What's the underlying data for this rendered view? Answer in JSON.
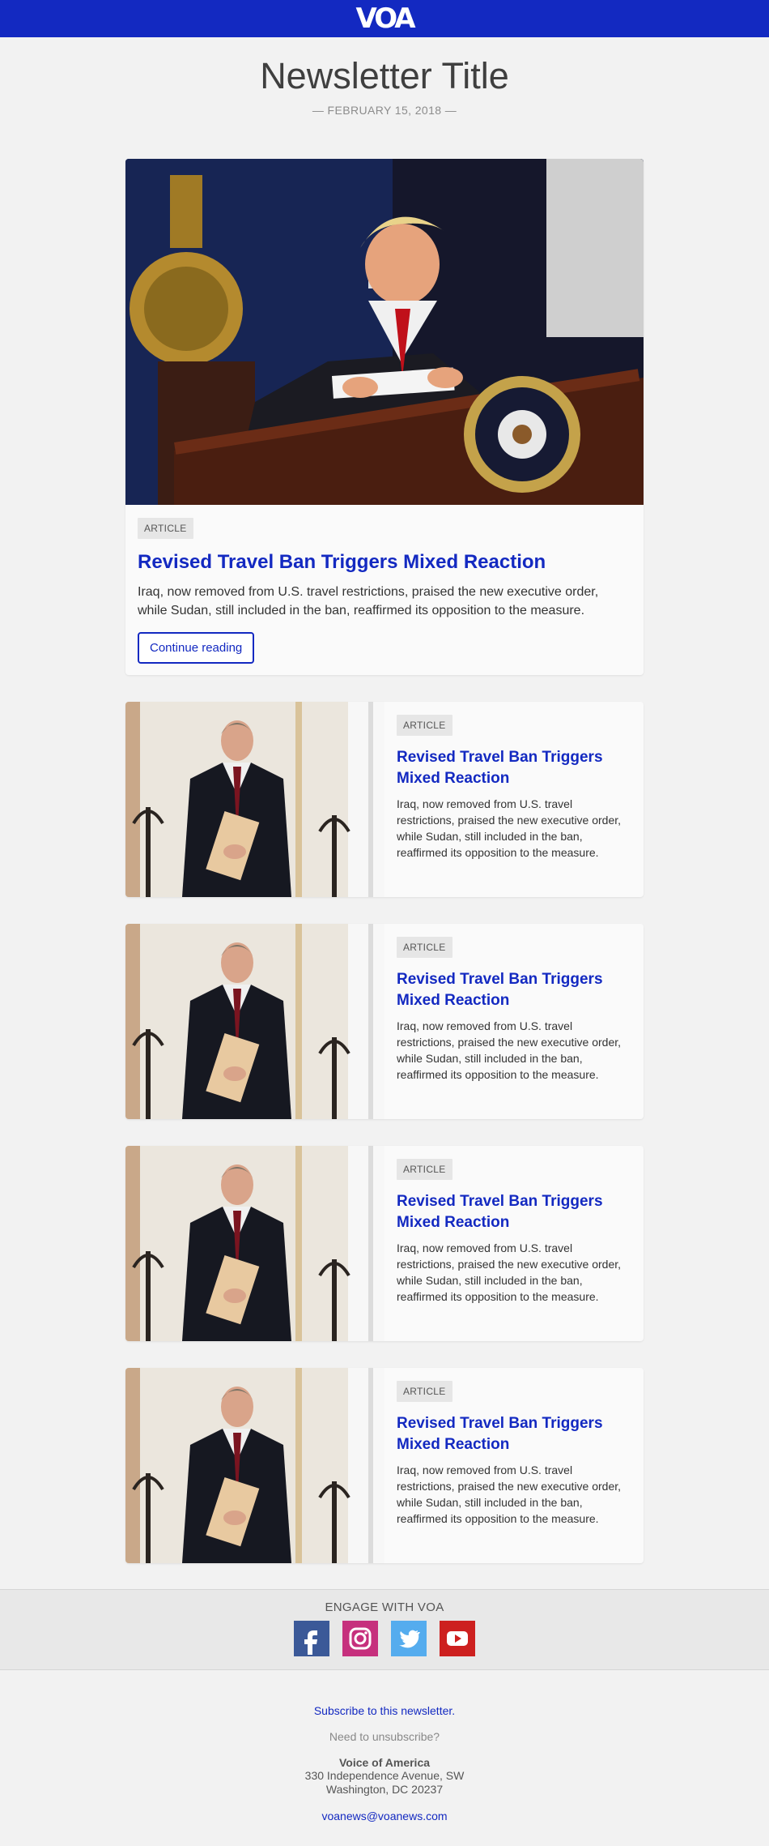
{
  "brand": {
    "logo_text": "VOA",
    "accent": "#1329c1"
  },
  "header": {
    "title": "Newsletter Title",
    "date": "— FEBRUARY 15, 2018 —"
  },
  "hero": {
    "tag": "ARTICLE",
    "headline": "Revised Travel Ban Triggers Mixed Reaction",
    "summary": "Iraq, now removed from U.S. travel restrictions, praised the new executive order, while Sudan, still included in the ban, reaffirmed its opposition to the measure.",
    "cta": "Continue reading"
  },
  "articles": [
    {
      "tag": "ARTICLE",
      "headline": "Revised Travel Ban Triggers Mixed Reaction",
      "summary": "Iraq, now removed from U.S. travel restrictions, praised the new executive order, while Sudan, still included in the ban, reaffirmed its opposition to the measure."
    },
    {
      "tag": "ARTICLE",
      "headline": "Revised Travel Ban Triggers Mixed Reaction",
      "summary": "Iraq, now removed from U.S. travel restrictions, praised the new executive order, while Sudan, still included in the ban, reaffirmed its opposition to the measure."
    },
    {
      "tag": "ARTICLE",
      "headline": "Revised Travel Ban Triggers Mixed Reaction",
      "summary": "Iraq, now removed from U.S. travel restrictions, praised the new executive order, while Sudan, still included in the ban, reaffirmed its opposition to the measure."
    },
    {
      "tag": "ARTICLE",
      "headline": "Revised Travel Ban Triggers Mixed Reaction",
      "summary": "Iraq, now removed from U.S. travel restrictions, praised the new executive order, while Sudan, still included in the ban, reaffirmed its opposition to the measure."
    }
  ],
  "engage": {
    "title": "ENGAGE WITH VOA",
    "icons": [
      "facebook-icon",
      "instagram-icon",
      "twitter-icon",
      "youtube-icon"
    ]
  },
  "footer": {
    "subscribe": "Subscribe to this newsletter.",
    "unsubscribe": "Need to unsubscribe?",
    "org": "Voice of America",
    "address_line1": "330 Independence Avenue, SW",
    "address_line2": "Washington, DC 20237",
    "email": "voanews@voanews.com"
  }
}
